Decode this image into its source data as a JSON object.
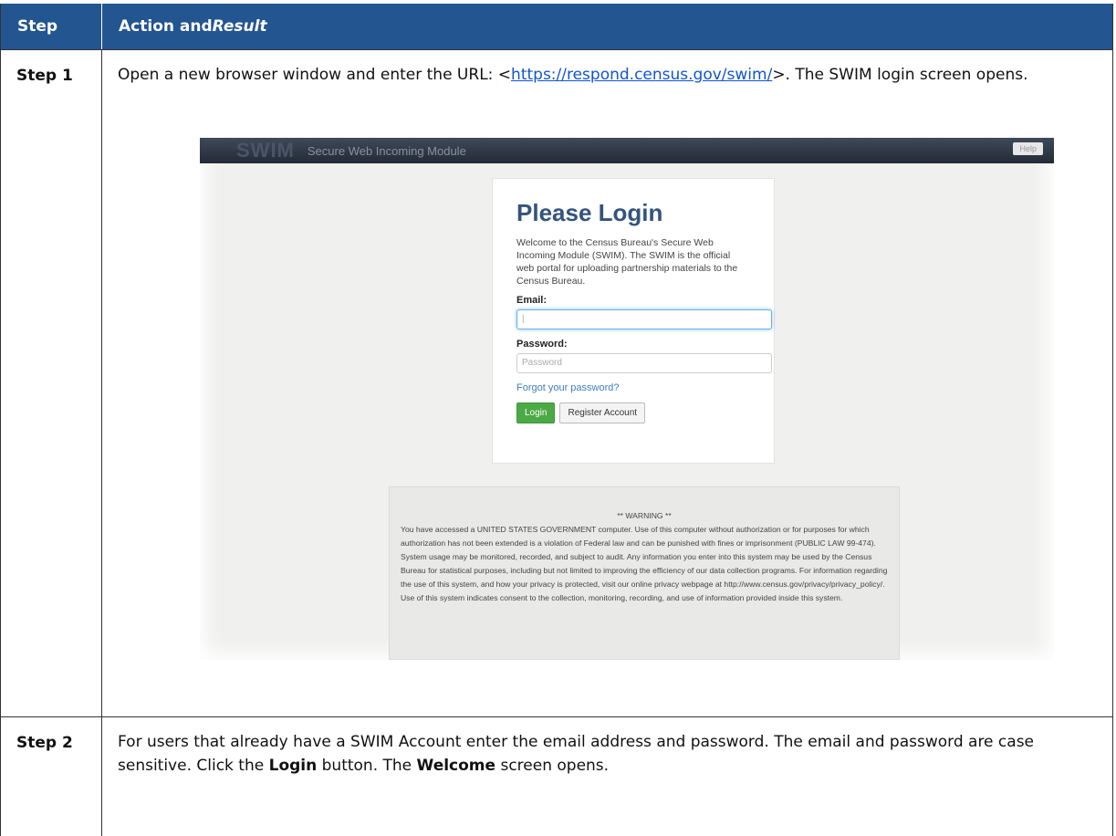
{
  "table": {
    "header": {
      "step": "Step",
      "action": "Action and ",
      "result": "Result"
    },
    "rows": [
      {
        "step": "Step 1",
        "text_a": "Open a new browser window and enter the URL: <",
        "url": "https://respond.census.gov/swim/",
        "text_b": ">. The SWIM login screen opens."
      },
      {
        "step": "Step 2",
        "text_a": "For users that already have a SWIM Account enter the email address and password. The email and password are case sensitive. Click the ",
        "bold_a": "Login",
        "text_b": " button. The ",
        "bold_b": "Welcome",
        "text_c": " screen opens."
      }
    ]
  },
  "screenshot": {
    "app_logo": "SWIM",
    "app_subtitle": "Secure Web Incoming Module",
    "help_label": "Help",
    "login": {
      "title": "Please Login",
      "description": "Welcome to the Census Bureau's Secure Web Incoming Module (SWIM). The SWIM is the official web portal for uploading partnership materials to the Census Bureau.",
      "email_label": "Email:",
      "email_value": "|",
      "password_label": "Password:",
      "password_placeholder": "Password",
      "forgot_link": "Forgot your password?",
      "login_button": "Login",
      "register_button": "Register Account"
    },
    "warning": {
      "title": "** WARNING **",
      "body": "You have accessed a UNITED STATES GOVERNMENT computer. Use of this computer without authorization or for purposes for which authorization has not been extended is a violation of Federal law and can be punished with fines or imprisonment (PUBLIC LAW 99-474). System usage may be monitored, recorded, and subject to audit. Any information you enter into this system may be used by the Census Bureau for statistical purposes, including but not limited to improving the efficiency of our data collection programs. For information regarding the use of this system, and how your privacy is protected, visit our online privacy webpage at http://www.census.gov/privacy/privacy_policy/. Use of this system indicates consent to the collection, monitoring, recording, and use of information provided inside this system."
    }
  }
}
